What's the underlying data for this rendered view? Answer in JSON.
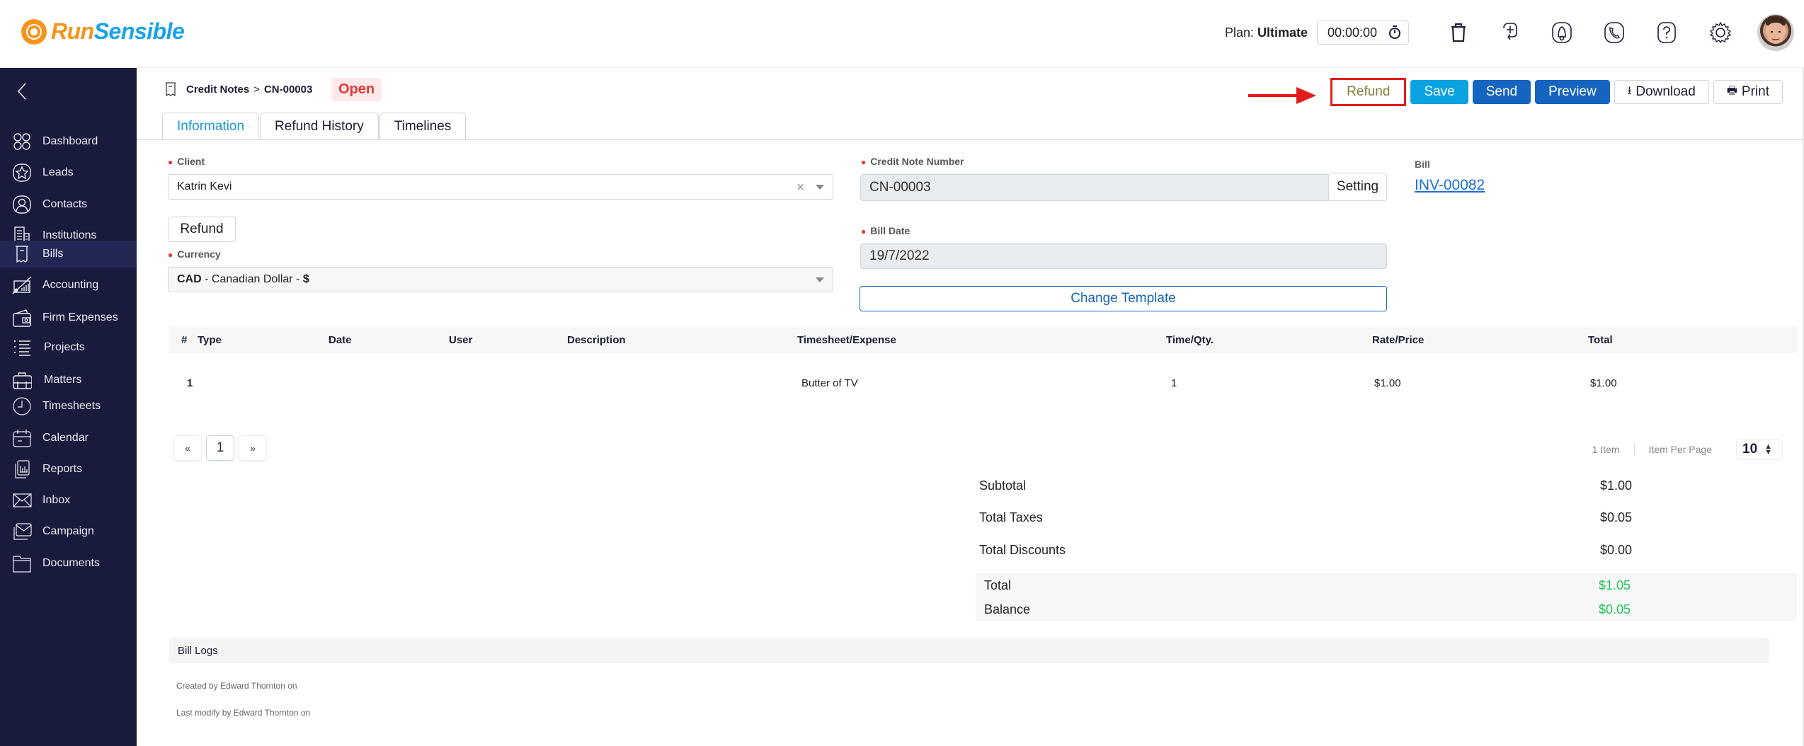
{
  "brand": {
    "name_part1": "Run",
    "name_part2": "Sensible"
  },
  "header": {
    "plan_label": "Plan:",
    "plan_value": "Ultimate",
    "timer": "00:00:00",
    "icons": [
      "trash-icon",
      "add-task-icon",
      "notification-bell-icon",
      "phone-icon",
      "help-icon",
      "settings-gear-icon"
    ]
  },
  "sidebar": {
    "items": [
      {
        "label": "Dashboard",
        "icon": "dashboard-icon"
      },
      {
        "label": "Leads",
        "icon": "star-icon"
      },
      {
        "label": "Contacts",
        "icon": "contact-icon"
      },
      {
        "label": "Institutions",
        "icon": "building-icon"
      },
      {
        "label": "Bills",
        "icon": "receipt-icon",
        "active": true
      },
      {
        "label": "Accounting",
        "icon": "accounting-icon"
      },
      {
        "label": "Firm Expenses",
        "icon": "wallet-icon"
      },
      {
        "label": "Projects",
        "icon": "list-icon"
      },
      {
        "label": "Matters",
        "icon": "briefcase-icon"
      },
      {
        "label": "Timesheets",
        "icon": "clock-icon"
      },
      {
        "label": "Calendar",
        "icon": "calendar-icon"
      },
      {
        "label": "Reports",
        "icon": "report-icon"
      },
      {
        "label": "Inbox",
        "icon": "mail-icon"
      },
      {
        "label": "Campaign",
        "icon": "campaign-icon"
      },
      {
        "label": "Documents",
        "icon": "folder-icon"
      }
    ]
  },
  "page": {
    "breadcrumb": {
      "parent": "Credit Notes",
      "separator": ">",
      "current": "CN-00003"
    },
    "status": "Open",
    "tabs": [
      {
        "label": "Information",
        "active": true
      },
      {
        "label": "Refund History"
      },
      {
        "label": "Timelines"
      }
    ],
    "actions": {
      "refund": "Refund",
      "save": "Save",
      "send": "Send",
      "preview": "Preview",
      "download": "Download",
      "print": "Print"
    }
  },
  "form": {
    "client_label": "Client",
    "client_value": "Katrin Kevi",
    "refund_button": "Refund",
    "currency_label": "Currency",
    "currency_code": "CAD",
    "currency_rest": " - Canadian Dollar - ",
    "currency_symbol": "$",
    "credit_note_number_label": "Credit Note Number",
    "credit_note_number_value": "CN-00003",
    "setting_button": "Setting",
    "bill_date_label": "Bill Date",
    "bill_date_value": "19/7/2022",
    "change_template_button": "Change Template",
    "bill_label": "Bill",
    "bill_link": "INV-00082"
  },
  "table": {
    "headers": [
      "#",
      "Type",
      "Date",
      "User",
      "Description",
      "Timesheet/Expense",
      "Time/Qty.",
      "Rate/Price",
      "Total"
    ],
    "rows": [
      {
        "num": "1",
        "type": "",
        "date": "",
        "user": "",
        "description": "",
        "timesheet": "Butter of TV",
        "qty": "1",
        "rate": "$1.00",
        "total": "$1.00"
      }
    ]
  },
  "pagination": {
    "prev": "«",
    "current": "1",
    "next": "»",
    "item_count": "1 Item",
    "per_page_label": "Item Per Page",
    "per_page_value": "10"
  },
  "totals": {
    "subtotal_label": "Subtotal",
    "subtotal": "$1.00",
    "taxes_label": "Total Taxes",
    "taxes": "$0.05",
    "discounts_label": "Total Discounts",
    "discounts": "$0.00",
    "total_label": "Total",
    "total": "$1.05",
    "balance_label": "Balance",
    "balance": "$0.05"
  },
  "logs": {
    "title": "Bill Logs",
    "created": "Created by Edward Thornton on",
    "modified": "Last modify by Edward Thornton on"
  }
}
